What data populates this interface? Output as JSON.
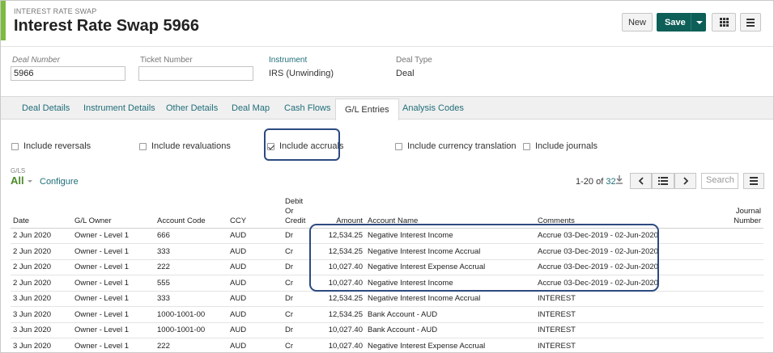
{
  "header": {
    "subtitle": "INTEREST RATE SWAP",
    "title": "Interest Rate Swap 5966",
    "new_label": "New",
    "save_label": "Save"
  },
  "deal": {
    "deal_number_label": "Deal Number",
    "deal_number_value": "5966",
    "ticket_number_label": "Ticket Number",
    "ticket_number_value": "",
    "instrument_label": "Instrument",
    "instrument_value": "IRS (Unwinding)",
    "deal_type_label": "Deal Type",
    "deal_type_value": "Deal"
  },
  "tabs": [
    "Deal Details",
    "Instrument Details",
    "Other Details",
    "Deal Map",
    "Cash Flows",
    "G/L Entries",
    "Analysis Codes"
  ],
  "active_tab": "G/L Entries",
  "filters": [
    {
      "label": "Include reversals",
      "checked": false
    },
    {
      "label": "Include revaluations",
      "checked": false
    },
    {
      "label": "Include accruals",
      "checked": true
    },
    {
      "label": "Include currency translation",
      "checked": false
    },
    {
      "label": "Include journals",
      "checked": false
    }
  ],
  "gls": {
    "label": "G/LS",
    "selected": "All",
    "configure_label": "Configure"
  },
  "pager": {
    "range": "1-20",
    "of": "of",
    "total": "32",
    "search_placeholder": "Search"
  },
  "table": {
    "columns": [
      "Date",
      "G/L Owner",
      "Account Code",
      "CCY",
      "Debit Or Credit",
      "Amount",
      "Account Name",
      "Comments",
      "Journal Number"
    ],
    "rows": [
      [
        "2 Jun 2020",
        "Owner - Level 1",
        "666",
        "AUD",
        "Dr",
        "12,534.25",
        "Negative Interest Income",
        "Accrue 03-Dec-2019 - 02-Jun-2020",
        ""
      ],
      [
        "2 Jun 2020",
        "Owner - Level 1",
        "333",
        "AUD",
        "Cr",
        "12,534.25",
        "Negative Interest Income Accrual",
        "Accrue 03-Dec-2019 - 02-Jun-2020",
        ""
      ],
      [
        "2 Jun 2020",
        "Owner - Level 1",
        "222",
        "AUD",
        "Dr",
        "10,027.40",
        "Negative Interest Expense Accrual",
        "Accrue 03-Dec-2019 - 02-Jun-2020",
        ""
      ],
      [
        "2 Jun 2020",
        "Owner - Level 1",
        "555",
        "AUD",
        "Cr",
        "10,027.40",
        "Negative Interest Income",
        "Accrue 03-Dec-2019 - 02-Jun-2020",
        ""
      ],
      [
        "3 Jun 2020",
        "Owner - Level 1",
        "333",
        "AUD",
        "Dr",
        "12,534.25",
        "Negative Interest Income Accrual",
        "INTEREST",
        ""
      ],
      [
        "3 Jun 2020",
        "Owner - Level 1",
        "1000-1001-00",
        "AUD",
        "Cr",
        "12,534.25",
        "Bank Account - AUD",
        "INTEREST",
        ""
      ],
      [
        "3 Jun 2020",
        "Owner - Level 1",
        "1000-1001-00",
        "AUD",
        "Dr",
        "10,027.40",
        "Bank Account - AUD",
        "INTEREST",
        ""
      ],
      [
        "3 Jun 2020",
        "Owner - Level 1",
        "222",
        "AUD",
        "Cr",
        "10,027.40",
        "Negative Interest Expense Accrual",
        "INTEREST",
        ""
      ]
    ]
  },
  "colors": {
    "accent": "#7dba40",
    "save": "#0d5f58",
    "link": "#1f6e79",
    "highlight": "#2c4a80"
  }
}
